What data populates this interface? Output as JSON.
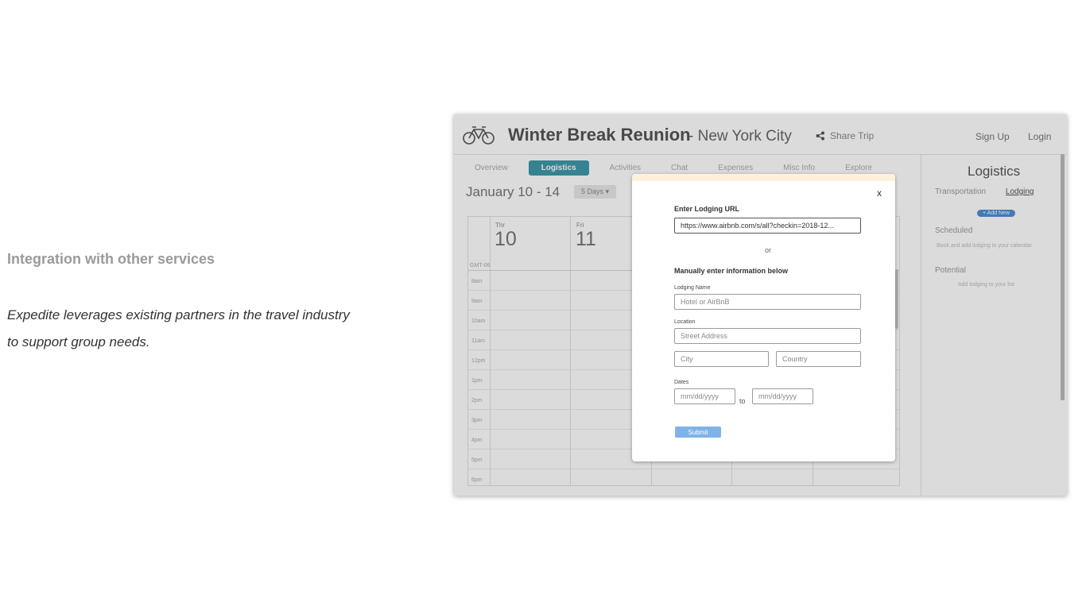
{
  "slide": {
    "heading": "Integration with other services",
    "body_line1": "Expedite leverages existing partners in the travel industry",
    "body_line2": "to support group needs."
  },
  "app": {
    "trip_title": "Winter Break Reunion",
    "trip_city": "- New York City",
    "share_label": "Share Trip",
    "sign_up": "Sign Up",
    "login": "Login",
    "tabs": [
      "Overview",
      "Logistics",
      "Activities",
      "Chat",
      "Expenses",
      "Misc Info",
      "Explore"
    ],
    "active_tab": "Logistics",
    "date_range": "January 10 - 14",
    "days_button": "5 Days ▾",
    "calendar": {
      "days": [
        {
          "label": "Thr",
          "num": "10"
        },
        {
          "label": "Fri",
          "num": "11"
        }
      ],
      "timezone": "GMT-06",
      "hours": [
        "8am",
        "9am",
        "10am",
        "11am",
        "12pm",
        "1pm",
        "2pm",
        "3pm",
        "4pm",
        "5pm",
        "6pm"
      ]
    },
    "side_panel": {
      "title": "Logistics",
      "tab_transportation": "Transportation",
      "tab_lodging": "Lodging",
      "add_new": "+ Add New",
      "scheduled": "Scheduled",
      "scheduled_sub": "Book and add lodging to your calendar",
      "potential": "Potential",
      "potential_sub": "Add lodging to your list"
    }
  },
  "modal": {
    "close": "x",
    "url_label": "Enter Lodging URL",
    "url_value": "https://www.airbnb.com/s/all?checkin=2018-12...",
    "or": "or",
    "manual_label": "Manually enter information below",
    "lodging_name_label": "Lodging Name",
    "lodging_name_placeholder": "Hotel or AirBnB",
    "location_label": "Location",
    "street_placeholder": "Street Address",
    "city_placeholder": "City",
    "country_placeholder": "Country",
    "dates_label": "Dates",
    "date_from_placeholder": "mm/dd/yyyy",
    "to": "to",
    "date_to_placeholder": "mm/dd/yyyy",
    "submit": "Submit"
  },
  "colors": {
    "accent": "#3e99a8",
    "submit": "#7fb3e8",
    "modal_band": "#fdf1dc"
  }
}
